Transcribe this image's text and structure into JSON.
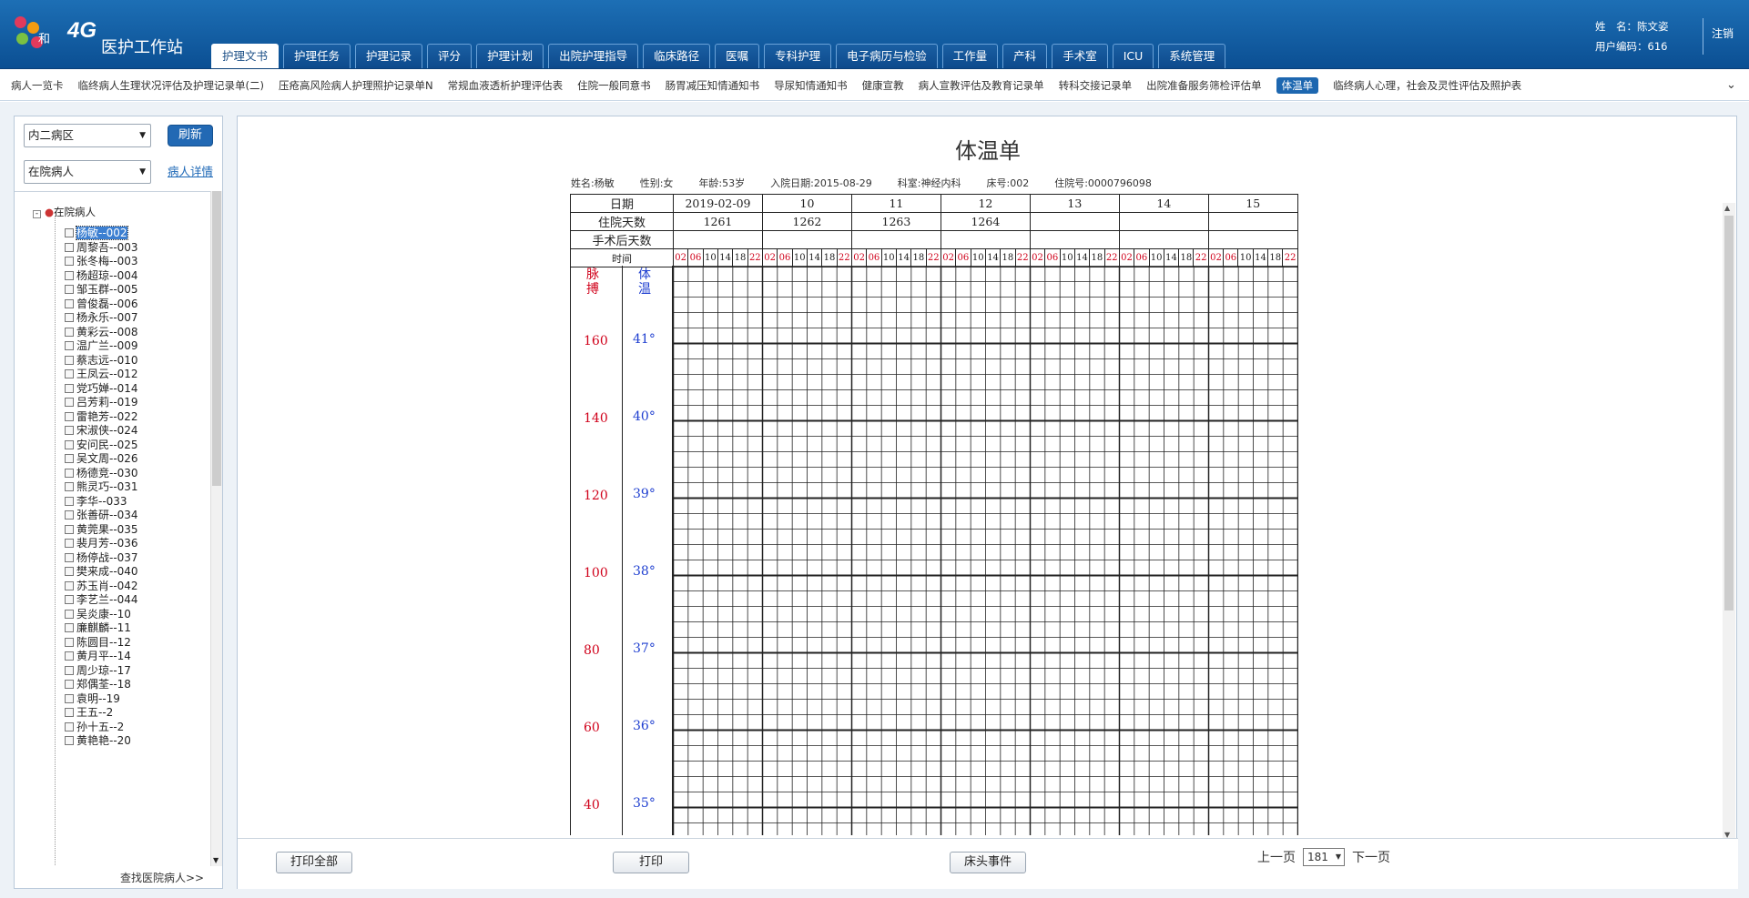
{
  "app": {
    "logo_text": "and和",
    "logo_4g": "4G",
    "title": "医护工作站"
  },
  "main_tabs": [
    "护理文书",
    "护理任务",
    "护理记录",
    "评分",
    "护理计划",
    "出院护理指导",
    "临床路径",
    "医嘱",
    "专科护理",
    "电子病历与检验",
    "工作量",
    "产科",
    "手术室",
    "ICU",
    "系统管理"
  ],
  "active_main_tab": "护理文书",
  "user": {
    "name_line": "姓　名：陈文姿",
    "code_line": "用户编码：616",
    "logout": "注销"
  },
  "sub_tabs": [
    "病人一览卡",
    "临终病人生理状况评估及护理记录单(二)",
    "压疮高风险病人护理照护记录单N",
    "常规血液透析护理评估表",
    "住院一般同意书",
    "肠胃减压知情通知书",
    "导尿知情通知书",
    "健康宣教",
    "病人宣教评估及教育记录单",
    "转科交接记录单",
    "出院准备服务筛检评估单",
    "体温单",
    "临终病人心理，社会及灵性评估及照护表"
  ],
  "active_sub_tab": "体温单",
  "sidebar": {
    "ward_select": "内二病区",
    "refresh": "刷新",
    "status_select": "在院病人",
    "detail_link": "病人详情",
    "tree_root": "在院病人",
    "find_patient": "查找医院病人>>",
    "patients": [
      "杨敏--002",
      "周黎吾--003",
      "张冬梅--003",
      "杨超琼--004",
      "邹玉群--005",
      "曾俊磊--006",
      "杨永乐--007",
      "黄彩云--008",
      "温广兰--009",
      "蔡志远--010",
      "王凤云--012",
      "党巧婵--014",
      "吕芳莉--019",
      "雷艳芳--022",
      "宋淑侠--024",
      "安问民--025",
      "吴文周--026",
      "杨德竞--030",
      "熊灵巧--031",
      "李华--033",
      "张善研--034",
      "黄莞果--035",
      "裴月芳--036",
      "杨停战--037",
      "樊来成--040",
      "苏玉肖--042",
      "李艺兰--044",
      "吴炎康--10",
      "廉麒麟--11",
      "陈圆目--12",
      "黄月平--14",
      "周少琼--17",
      "郑偶荃--18",
      "袁明--19",
      "王五--2",
      "孙十五--2",
      "黄艳艳--20"
    ],
    "selected": "杨敏--002"
  },
  "chart": {
    "title": "体温单",
    "patient_info": [
      "姓名:杨敏",
      "性别:女",
      "年龄:53岁",
      "入院日期:2015-08-29",
      "科室:神经内科",
      "床号:002",
      "住院号:0000796098"
    ],
    "row_labels": {
      "date": "日期",
      "days": "住院天数",
      "postop": "手术后天数",
      "time": "时间"
    },
    "dates": [
      "2019-02-09",
      "10",
      "11",
      "12",
      "13",
      "14",
      "15"
    ],
    "hospital_days": [
      "1261",
      "1262",
      "1263",
      "1264",
      "",
      "",
      ""
    ],
    "times": [
      "02",
      "06",
      "10",
      "14",
      "18",
      "22"
    ],
    "red_times": [
      "02",
      "06",
      "22"
    ],
    "pulse_label": "脉搏",
    "temp_label": "体温",
    "pulse_scale": [
      "160",
      "140",
      "120",
      "100",
      "80",
      "60",
      "40"
    ],
    "temp_scale": [
      "41°",
      "40°",
      "39°",
      "38°",
      "37°",
      "36°",
      "35°"
    ],
    "colors": {
      "pulse": "#d0021b",
      "temp": "#1f3fd0"
    }
  },
  "bottom": {
    "print_all": "打印全部",
    "print": "打印",
    "bed_event": "床头事件",
    "prev": "上一页",
    "page": "181",
    "next": "下一页"
  }
}
